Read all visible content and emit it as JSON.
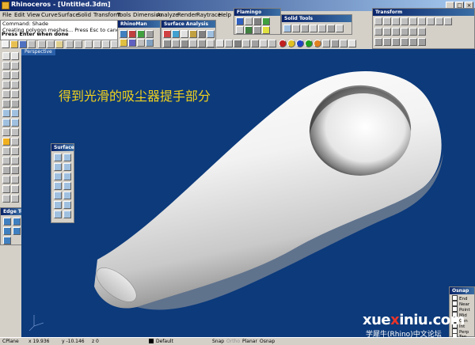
{
  "window": {
    "title": "Rhinoceros - [Untitled.3dm]"
  },
  "menu": {
    "items": [
      "File",
      "Edit",
      "View",
      "Curve",
      "Surface",
      "Solid",
      "Transform",
      "Tools",
      "Dimension",
      "Analyze",
      "Render",
      "Raytrace",
      "Help"
    ]
  },
  "command": {
    "lines": [
      "Command: Shade",
      "Creating polygon meshes... Press Esc to cancel"
    ],
    "prompt": "Press Enter when done"
  },
  "toolbars": {
    "rhinoman": "RhinoMan",
    "surface_analysis": "Surface Analysis",
    "flamingo": "Flamingo",
    "solid_tools": "Solid Tools",
    "transform": "Transform",
    "surface": "Surface",
    "edge_tools": "Edge Too"
  },
  "viewport": {
    "label": "Perspective",
    "caption": "得到光滑的吸尘器提手部分"
  },
  "status": {
    "cplane": "CPlane",
    "x": "x 19.936",
    "y": "y -10.146",
    "z": "z 0",
    "layer": "Default",
    "snap": "Snap",
    "ortho": "Ortho",
    "planar": "Planar",
    "osnap": "Osnap"
  },
  "osnap_panel": {
    "title": "Osnap",
    "items": [
      "End",
      "Near",
      "Point",
      "Mid",
      "Cen",
      "Int",
      "Perp",
      "Tan",
      "Quad",
      "Knot"
    ]
  },
  "watermark": {
    "brand_prefix": "xue",
    "brand_x": "x",
    "brand_suffix": "iniu.com",
    "subtitle": "学犀牛(Rhino)中文论坛"
  },
  "colors": {
    "viewport_bg": "#0c3a7b",
    "caption": "#f2d21c",
    "title_bar": "#0a246a"
  }
}
